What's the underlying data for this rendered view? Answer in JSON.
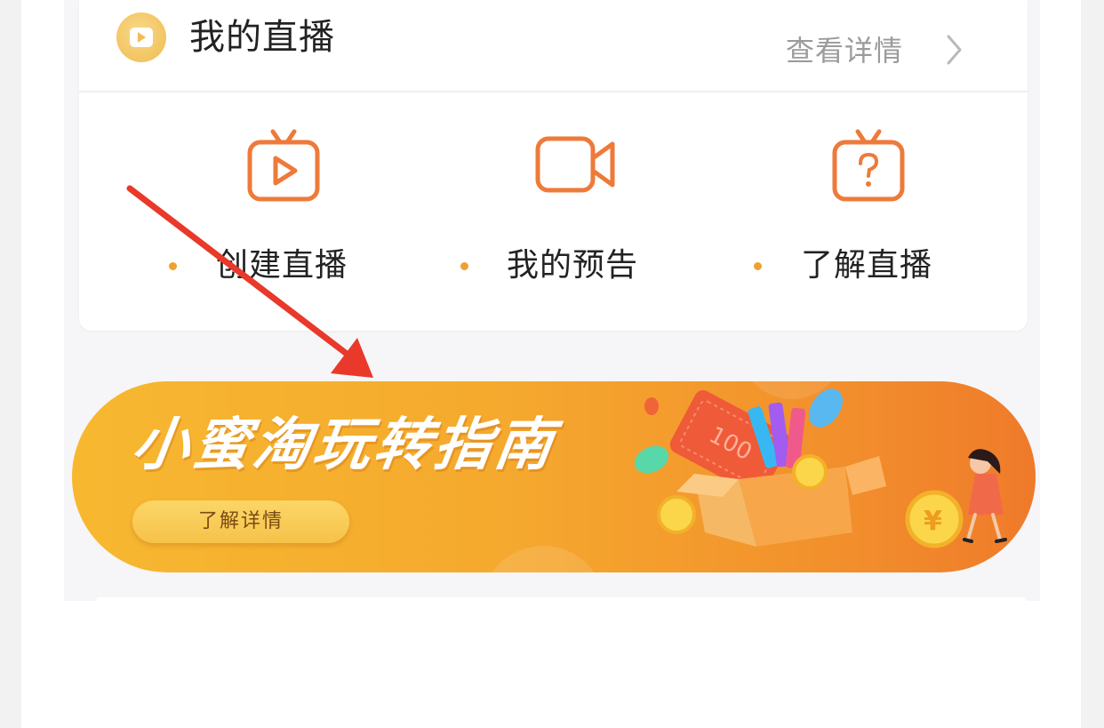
{
  "live_card": {
    "title": "我的直播",
    "view_details": "查看详情",
    "actions": [
      {
        "label": "创建直播",
        "icon": "tv-play-icon"
      },
      {
        "label": "我的预告",
        "icon": "video-camera-icon"
      },
      {
        "label": "了解直播",
        "icon": "tv-question-icon"
      }
    ]
  },
  "banner": {
    "title": "小蜜淘玩转指南",
    "button_label": "了解详情",
    "art_text": {
      "ticket": "100",
      "coin": "¥"
    }
  },
  "colors": {
    "accent_orange": "#EE7A3A",
    "dot_orange": "#F0A030",
    "banner_start": "#F7B830",
    "banner_end": "#EF7A2A",
    "annotation_arrow": "#E8392A"
  }
}
